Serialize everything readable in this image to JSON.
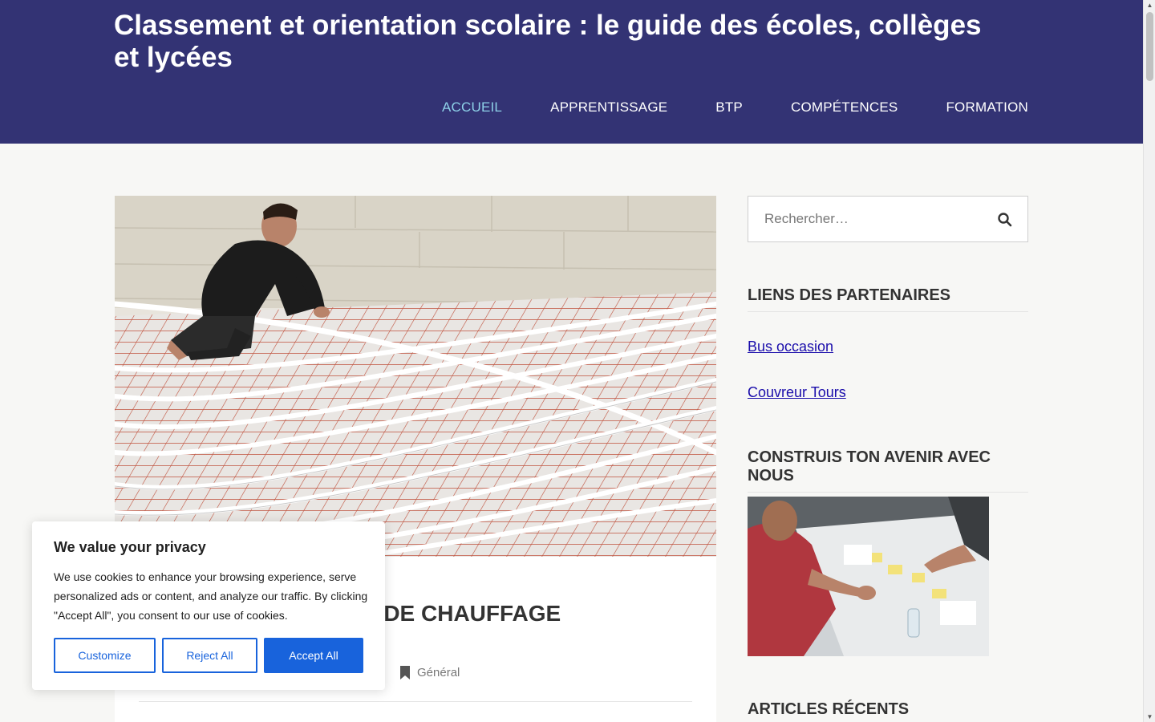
{
  "header": {
    "site_title": "Classement et orientation scolaire : le guide des écoles, collèges et lycées",
    "nav": [
      {
        "label": "ACCUEIL",
        "active": true
      },
      {
        "label": "APPRENTISSAGE",
        "active": false
      },
      {
        "label": "BTP",
        "active": false
      },
      {
        "label": "COMPÉTENCES",
        "active": false
      },
      {
        "label": "FORMATION",
        "active": false
      }
    ]
  },
  "article": {
    "title_visible": "SYSTÈME DE CHAUFFAGE",
    "category": "Général",
    "category_icon": "bookmark-icon",
    "image_description": "underfloor heating pipes installation"
  },
  "sidebar": {
    "search": {
      "placeholder": "Rechercher…",
      "icon": "search-icon"
    },
    "partners_title": "LIENS DES PARTENAIRES",
    "partner_links": [
      "Bus occasion",
      "Couvreur Tours"
    ],
    "future_title": "CONSTRUIS TON AVENIR AVEC NOUS",
    "recent_title": "ARTICLES RÉCENTS"
  },
  "cookie": {
    "title": "We value your privacy",
    "text": "We use cookies to enhance your browsing experience, serve personalized ads or content, and analyze our traffic. By clicking \"Accept All\", you consent to our use of cookies.",
    "customize": "Customize",
    "reject": "Reject All",
    "accept": "Accept All"
  },
  "colors": {
    "header_bg": "#333374",
    "nav_active": "#8ed1e8",
    "link": "#1a0dab",
    "accent": "#1863dc"
  }
}
